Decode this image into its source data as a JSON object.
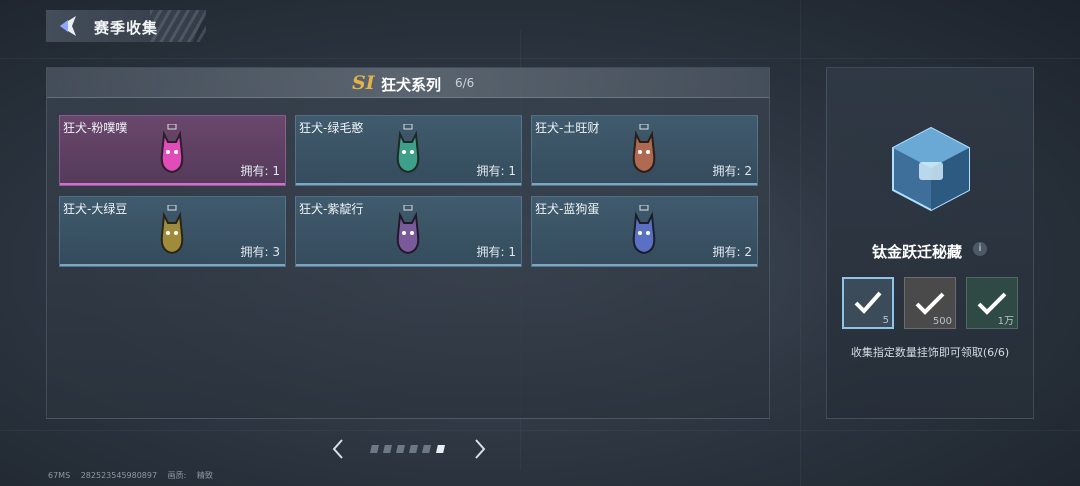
{
  "header": {
    "title": "赛季收集"
  },
  "panel": {
    "season_badge": "SI",
    "series_title": "狂犬系列",
    "series_count": "6/6",
    "items": [
      {
        "name": "狂犬-粉噗噗",
        "owned": "拥有: 1",
        "color": "#e04cb8",
        "selected": true
      },
      {
        "name": "狂犬-绿毛憨",
        "owned": "拥有: 1",
        "color": "#3fa08a"
      },
      {
        "name": "狂犬-土旺财",
        "owned": "拥有: 2",
        "color": "#b06a52"
      },
      {
        "name": "狂犬-大绿豆",
        "owned": "拥有: 3",
        "color": "#a08a3c"
      },
      {
        "name": "狂犬-紫靛行",
        "owned": "拥有: 1",
        "color": "#7a5a9a"
      },
      {
        "name": "狂犬-蓝狗蛋",
        "owned": "拥有: 2",
        "color": "#5a70c4"
      }
    ]
  },
  "pager": {
    "total": 6,
    "active_index": 5
  },
  "reward": {
    "name": "钛金跃迁秘藏",
    "info_icon": "i",
    "tiers": [
      {
        "value": "5",
        "icon": "check-icon",
        "state": "claimed"
      },
      {
        "value": "500",
        "icon": "check-icon",
        "state": "claimed"
      },
      {
        "value": "1万",
        "icon": "check-icon",
        "state": "claimed"
      }
    ],
    "description": "收集指定数量挂饰即可领取(6/6)"
  },
  "footer": {
    "fps": "67MS",
    "uid": "282523545980897",
    "quality_label": "画质:",
    "quality_value": "精致"
  },
  "colors": {
    "accent_pink": "#d36ed0",
    "gold": "#e5b24a",
    "card_blue": "#42607a"
  }
}
